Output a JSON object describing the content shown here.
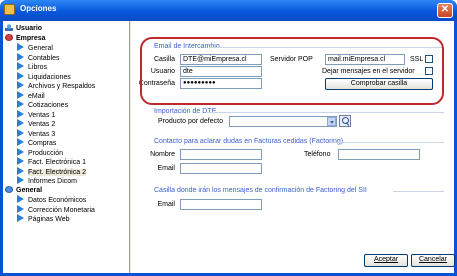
{
  "window": {
    "title": "Opciones"
  },
  "tree": {
    "items": [
      {
        "label": "Usuario",
        "level": 0,
        "icon": "user-icon",
        "bold": true
      },
      {
        "label": "Empresa",
        "level": 0,
        "icon": "company-icon",
        "bold": true
      },
      {
        "label": "General",
        "level": 1,
        "icon": "arrow-icon"
      },
      {
        "label": "Contables",
        "level": 1,
        "icon": "arrow-icon"
      },
      {
        "label": "Libros",
        "level": 1,
        "icon": "arrow-icon"
      },
      {
        "label": "Liquidaciones",
        "level": 1,
        "icon": "arrow-icon"
      },
      {
        "label": "Archivos y Respaldos",
        "level": 1,
        "icon": "arrow-icon"
      },
      {
        "label": "eMail",
        "level": 1,
        "icon": "arrow-icon"
      },
      {
        "label": "Cotizaciones",
        "level": 1,
        "icon": "arrow-icon"
      },
      {
        "label": "Ventas 1",
        "level": 1,
        "icon": "arrow-icon"
      },
      {
        "label": "Ventas 2",
        "level": 1,
        "icon": "arrow-icon"
      },
      {
        "label": "Ventas 3",
        "level": 1,
        "icon": "arrow-icon"
      },
      {
        "label": "Compras",
        "level": 1,
        "icon": "arrow-icon"
      },
      {
        "label": "Producción",
        "level": 1,
        "icon": "arrow-icon"
      },
      {
        "label": "Fact. Electrónica 1",
        "level": 1,
        "icon": "arrow-icon"
      },
      {
        "label": "Fact. Electrónica 2",
        "level": 1,
        "icon": "arrow-icon",
        "selected": true
      },
      {
        "label": "Informes Dicom",
        "level": 1,
        "icon": "arrow-icon"
      },
      {
        "label": "General",
        "level": 0,
        "icon": "globe-icon",
        "bold": true
      },
      {
        "label": "Datos Económicos",
        "level": 1,
        "icon": "arrow-icon"
      },
      {
        "label": "Corrección Monetaria",
        "level": 1,
        "icon": "arrow-icon"
      },
      {
        "label": "Páginas Web",
        "level": 1,
        "icon": "arrow-icon"
      }
    ]
  },
  "email_group": {
    "title": "Email de Intercambio",
    "casilla_label": "Casilla",
    "casilla_value": "DTE@miEmpresa.cl",
    "usuario_label": "Usuario",
    "usuario_value": "dte",
    "password_label": "Contraseña",
    "password_value": "●●●●●●●●●",
    "pop_label": "Servidor POP",
    "pop_value": "mail.miEmpresa.cl",
    "ssl_label": "SSL",
    "keep_label": "Dejar mensajes en el servidor",
    "check_button": "Comprobar casilla"
  },
  "import_group": {
    "title": "Importación de DTE",
    "product_label": "Producto por defecto",
    "product_value": ""
  },
  "contact_group": {
    "title": "Contacto para aclarar dudas en Facturas cedidas (Factoring)",
    "name_label": "Nombre",
    "email_label": "Email",
    "phone_label": "Teléfono"
  },
  "sii_group": {
    "title": "Casilla donde irán los mensajes de confirmación de Factoring del SII",
    "email_label": "Email"
  },
  "footer": {
    "accept": "Aceptar",
    "cancel": "Cancelar"
  },
  "colors": {
    "titlebar": "#0758dc",
    "group_title": "#3a5fcd",
    "highlight": "#c0282e"
  }
}
